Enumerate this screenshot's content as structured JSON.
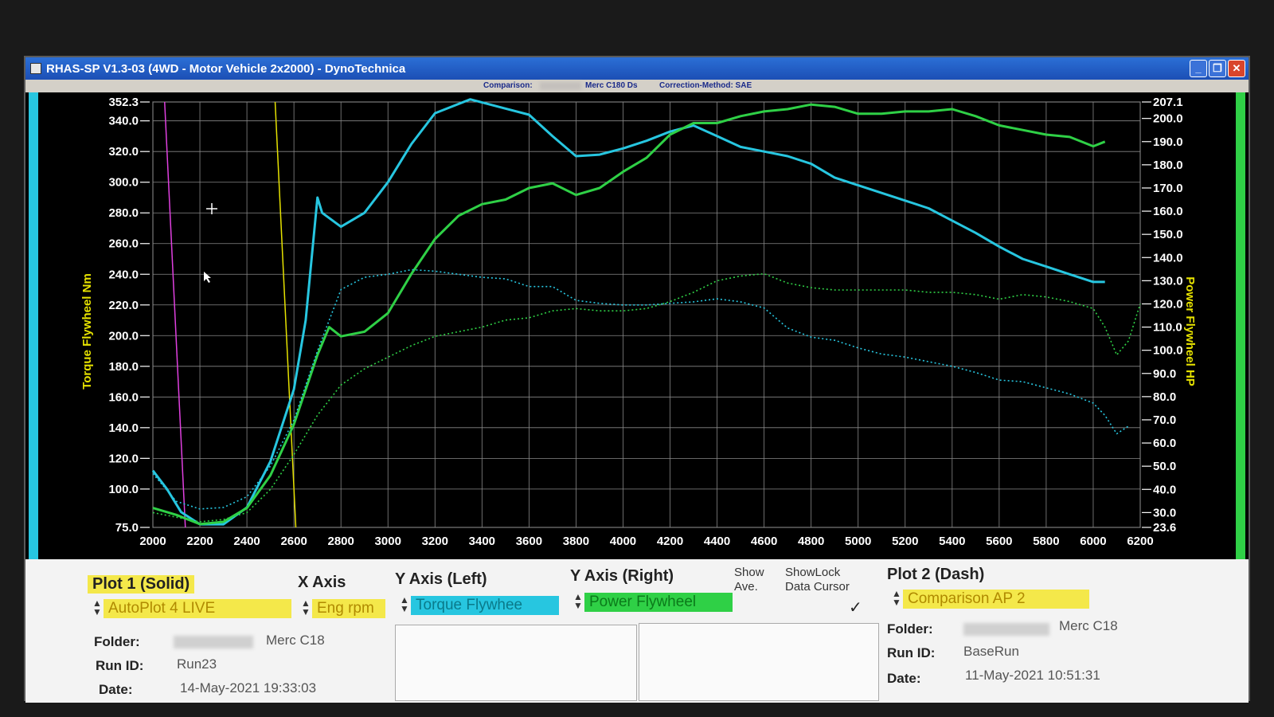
{
  "window": {
    "title": "RHAS-SP V1.3-03  (4WD - Motor Vehicle 2x2000) - DynoTechnica",
    "controls": {
      "minimize": "_",
      "maximize": "❐",
      "close": "✕"
    }
  },
  "infobar": {
    "comparison_label": "Comparison:",
    "comparison_value": "Merc C180 Ds",
    "correction_label": "Correction-Method: SAE"
  },
  "chart_data": {
    "type": "line",
    "xlabel": "",
    "ylabel_left": "Torque Flywheel Nm",
    "ylabel_right": "Power Flywheel HP",
    "xlim": [
      2000,
      6200
    ],
    "ylim_left": [
      75.0,
      352.3
    ],
    "ylim_right": [
      23.6,
      207.1
    ],
    "x_ticks": [
      "2000",
      "2200",
      "2400",
      "2600",
      "2800",
      "3000",
      "3200",
      "3400",
      "3600",
      "3800",
      "4000",
      "4200",
      "4400",
      "4600",
      "4800",
      "5000",
      "5200",
      "5400",
      "5600",
      "5800",
      "6000",
      "6200"
    ],
    "y_left_ticks": [
      "75.0",
      "100.0",
      "120.0",
      "140.0",
      "160.0",
      "180.0",
      "200.0",
      "220.0",
      "240.0",
      "260.0",
      "280.0",
      "300.0",
      "320.0",
      "340.0",
      "352.3"
    ],
    "y_right_ticks": [
      "23.6",
      "30.0",
      "40.0",
      "50.0",
      "60.0",
      "70.0",
      "80.0",
      "90.0",
      "100.0",
      "110.0",
      "120.0",
      "130.0",
      "140.0",
      "150.0",
      "160.0",
      "170.0",
      "180.0",
      "190.0",
      "200.0",
      "207.1"
    ],
    "grid": true,
    "series": [
      {
        "name": "Torque Flywheel",
        "style": "solid",
        "axis": "left",
        "color": "#27c6e0",
        "x": [
          2000,
          2060,
          2120,
          2200,
          2300,
          2400,
          2500,
          2600,
          2650,
          2700,
          2720,
          2800,
          2900,
          3000,
          3100,
          3200,
          3350,
          3500,
          3600,
          3700,
          3800,
          3900,
          4000,
          4100,
          4200,
          4300,
          4400,
          4500,
          4600,
          4700,
          4800,
          4900,
          5000,
          5100,
          5200,
          5300,
          5400,
          5500,
          5600,
          5700,
          5800,
          5900,
          6000,
          6050
        ],
        "y": [
          112,
          100,
          85,
          77,
          77,
          88,
          118,
          165,
          210,
          290,
          280,
          271,
          280,
          300,
          325,
          345,
          354,
          348,
          344,
          330,
          317,
          318,
          322,
          327,
          333,
          337,
          330,
          323,
          320,
          317,
          312,
          303,
          298,
          293,
          288,
          283,
          275,
          267,
          258,
          250,
          245,
          240,
          235,
          235
        ]
      },
      {
        "name": "Power Flywheel",
        "style": "solid",
        "axis": "right",
        "color": "#2fd046",
        "x": [
          2000,
          2100,
          2200,
          2300,
          2400,
          2500,
          2600,
          2700,
          2750,
          2800,
          2900,
          3000,
          3100,
          3200,
          3300,
          3400,
          3500,
          3600,
          3700,
          3800,
          3900,
          4000,
          4100,
          4200,
          4300,
          4400,
          4500,
          4600,
          4700,
          4800,
          4900,
          5000,
          5100,
          5200,
          5300,
          5400,
          5500,
          5600,
          5700,
          5800,
          5900,
          6000,
          6050
        ],
        "y": [
          32,
          29,
          25,
          26,
          32,
          46,
          68,
          98,
          110,
          106,
          108,
          116,
          133,
          148,
          158,
          163,
          165,
          170,
          172,
          167,
          170,
          177,
          183,
          193,
          198,
          198,
          201,
          203,
          204,
          206,
          205,
          202,
          202,
          203,
          203,
          204,
          201,
          197,
          195,
          193,
          192,
          188,
          190
        ]
      },
      {
        "name": "Torque Flywheel (Comparison AP 2)",
        "style": "dash",
        "axis": "left",
        "color": "#27c6e0",
        "x": [
          2000,
          2100,
          2200,
          2300,
          2400,
          2500,
          2600,
          2700,
          2800,
          2900,
          3000,
          3100,
          3200,
          3300,
          3400,
          3500,
          3600,
          3700,
          3800,
          3900,
          4000,
          4100,
          4200,
          4300,
          4400,
          4500,
          4600,
          4700,
          4800,
          4900,
          5000,
          5100,
          5200,
          5300,
          5400,
          5500,
          5600,
          5700,
          5800,
          5900,
          6000,
          6050,
          6100,
          6150
        ],
        "y": [
          110,
          92,
          87,
          88,
          95,
          115,
          145,
          190,
          230,
          238,
          240,
          243,
          242,
          240,
          238,
          237,
          232,
          232,
          223,
          221,
          220,
          220,
          221,
          222,
          224,
          222,
          218,
          205,
          199,
          197,
          192,
          188,
          186,
          183,
          180,
          176,
          171,
          170,
          166,
          162,
          156,
          148,
          136,
          141
        ]
      },
      {
        "name": "Power Flywheel (Comparison AP 2)",
        "style": "dash",
        "axis": "right",
        "color": "#2fd046",
        "x": [
          2000,
          2100,
          2200,
          2300,
          2400,
          2500,
          2600,
          2700,
          2800,
          2900,
          3000,
          3100,
          3200,
          3300,
          3400,
          3500,
          3600,
          3700,
          3800,
          3900,
          4000,
          4100,
          4200,
          4300,
          4400,
          4500,
          4600,
          4700,
          4800,
          4900,
          5000,
          5100,
          5200,
          5300,
          5400,
          5500,
          5600,
          5700,
          5800,
          5900,
          6000,
          6050,
          6100,
          6150,
          6200
        ],
        "y": [
          30,
          28,
          26,
          27,
          30,
          40,
          55,
          72,
          85,
          92,
          97,
          102,
          106,
          108,
          110,
          113,
          114,
          117,
          118,
          117,
          117,
          118,
          121,
          125,
          130,
          132,
          133,
          129,
          127,
          126,
          126,
          126,
          126,
          125,
          125,
          124,
          122,
          124,
          123,
          121,
          118,
          110,
          98,
          104,
          120
        ]
      }
    ],
    "markers": [
      {
        "x": 2050,
        "color": "#e040e0"
      },
      {
        "x": 2520,
        "color": "#e6e200"
      }
    ]
  },
  "controls": {
    "plot1": {
      "header": "Plot 1 (Solid)",
      "select": "AutoPlot 4 LIVE",
      "folder_label": "Folder:",
      "folder_value": "Merc C18",
      "runid_label": "Run ID:",
      "runid_value": "Run23",
      "date_label": "Date:",
      "date_value": "14-May-2021  19:33:03"
    },
    "xaxis": {
      "header": "X Axis",
      "select": "Eng rpm"
    },
    "yleft": {
      "header": "Y Axis (Left)",
      "select": "Torque Flywhee"
    },
    "yright": {
      "header": "Y Axis (Right)",
      "select": "Power Flywheel"
    },
    "show_ave": {
      "line1": "Show",
      "line2": "Ave."
    },
    "show_lock": {
      "line1": "ShowLock",
      "line2": "Data Cursor",
      "check": "✓"
    },
    "plot2": {
      "header": "Plot 2 (Dash)",
      "select": "Comparison AP 2",
      "folder_label": "Folder:",
      "folder_value": "Merc C18",
      "runid_label": "Run ID:",
      "runid_value": "BaseRun",
      "date_label": "Date:",
      "date_value": "11-May-2021  10:51:31"
    },
    "colors": {
      "yellow": "#f4e84a",
      "cyan": "#27c6e0",
      "green": "#2fd046"
    }
  }
}
